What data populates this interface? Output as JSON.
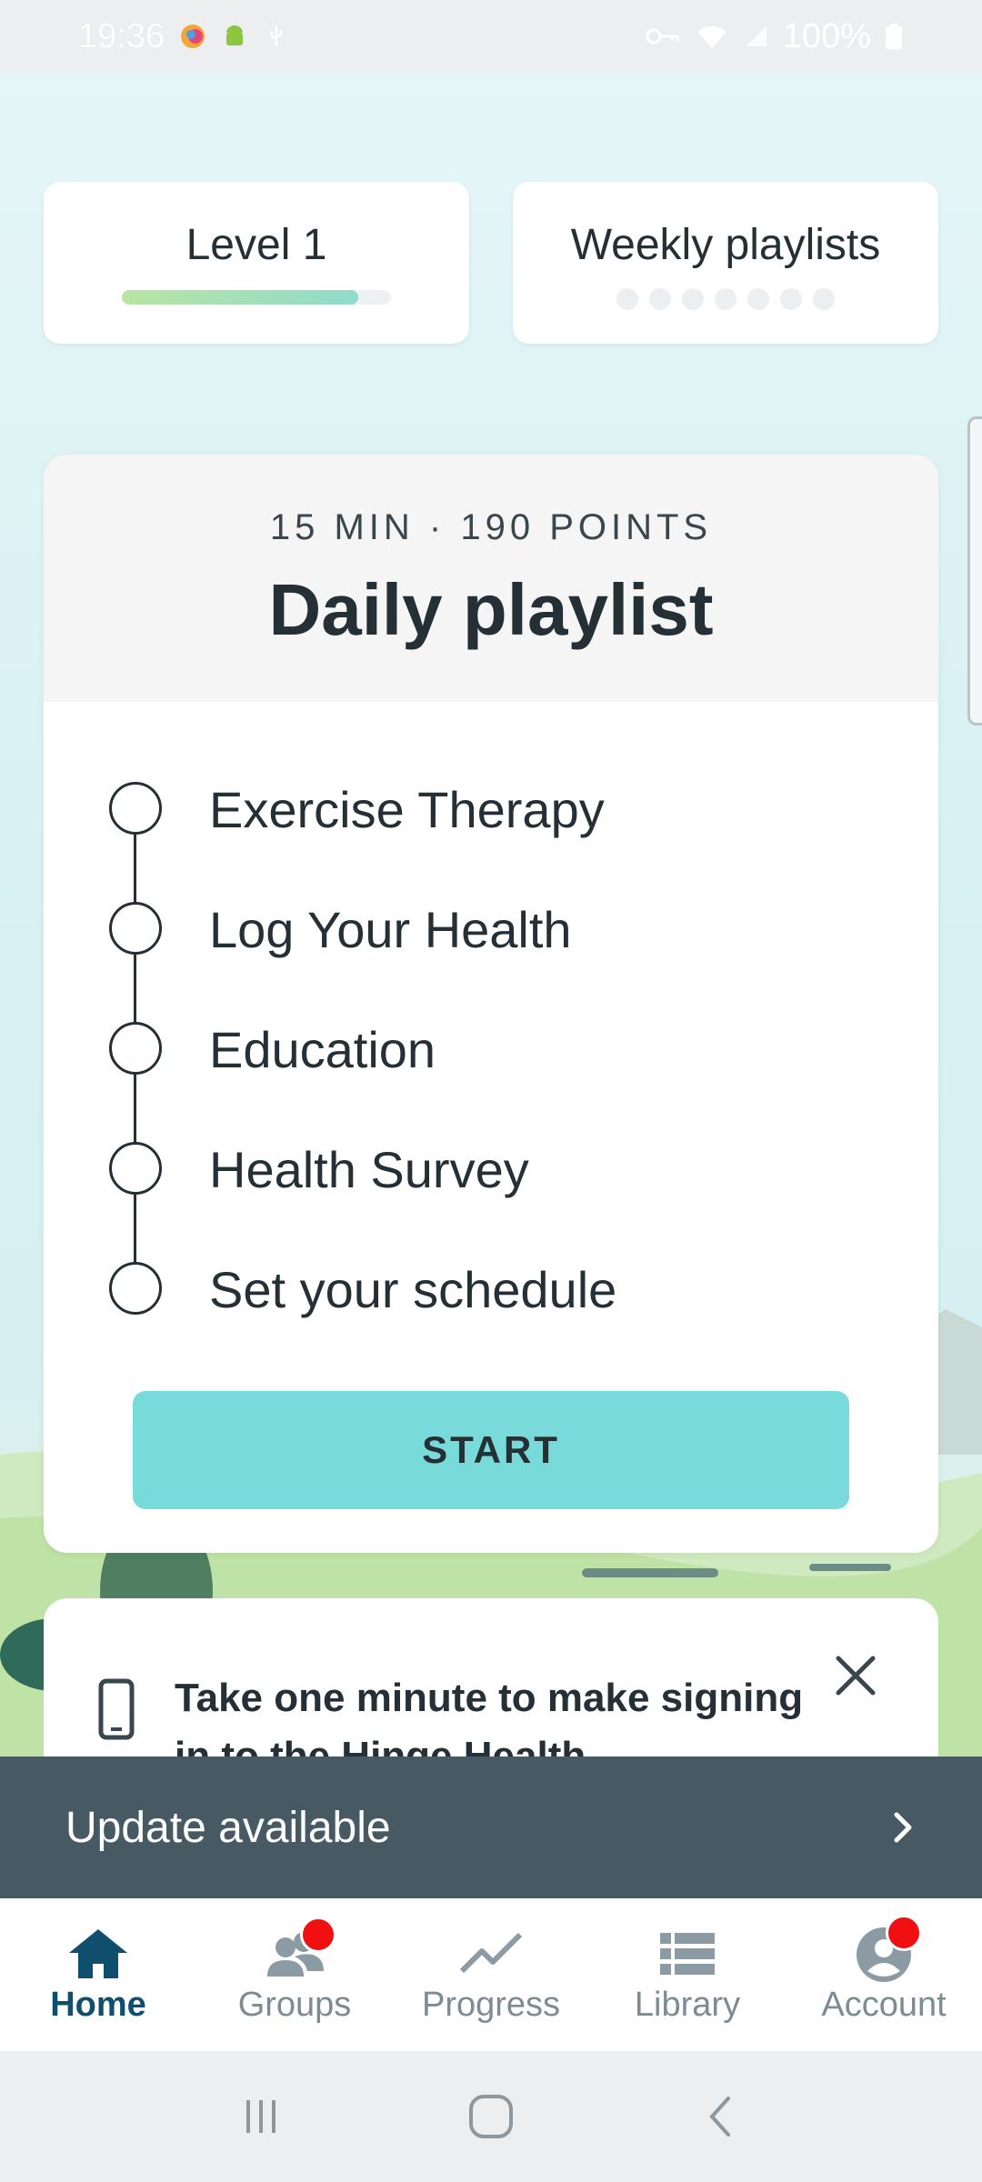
{
  "status_bar": {
    "time": "19:36",
    "battery": "100%"
  },
  "top_cards": {
    "level": {
      "title": "Level 1",
      "progress": 0.88
    },
    "weekly": {
      "title": "Weekly playlists",
      "completed": 0,
      "total": 7
    }
  },
  "playlist": {
    "meta": "15 MIN · 190 POINTS",
    "title": "Daily playlist",
    "items": [
      {
        "label": "Exercise Therapy"
      },
      {
        "label": "Log Your Health"
      },
      {
        "label": "Education"
      },
      {
        "label": "Health Survey"
      },
      {
        "label": "Set your schedule"
      }
    ],
    "start_label": "START"
  },
  "signin_card": {
    "text": "Take one minute to make signing in to the Hinge Health"
  },
  "update_banner": {
    "label": "Update available"
  },
  "bottom_nav": {
    "items": [
      {
        "label": "Home",
        "icon": "home-icon",
        "active": true,
        "badge": false
      },
      {
        "label": "Groups",
        "icon": "groups-icon",
        "active": false,
        "badge": true
      },
      {
        "label": "Progress",
        "icon": "progress-icon",
        "active": false,
        "badge": false
      },
      {
        "label": "Library",
        "icon": "library-icon",
        "active": false,
        "badge": false
      },
      {
        "label": "Account",
        "icon": "account-icon",
        "active": false,
        "badge": true
      }
    ]
  },
  "colors": {
    "accent": "#79dbd9",
    "nav_active": "#0f4f6d",
    "nav_inactive": "#7d8b93",
    "banner": "#475a64",
    "badge": "#f20f12"
  }
}
